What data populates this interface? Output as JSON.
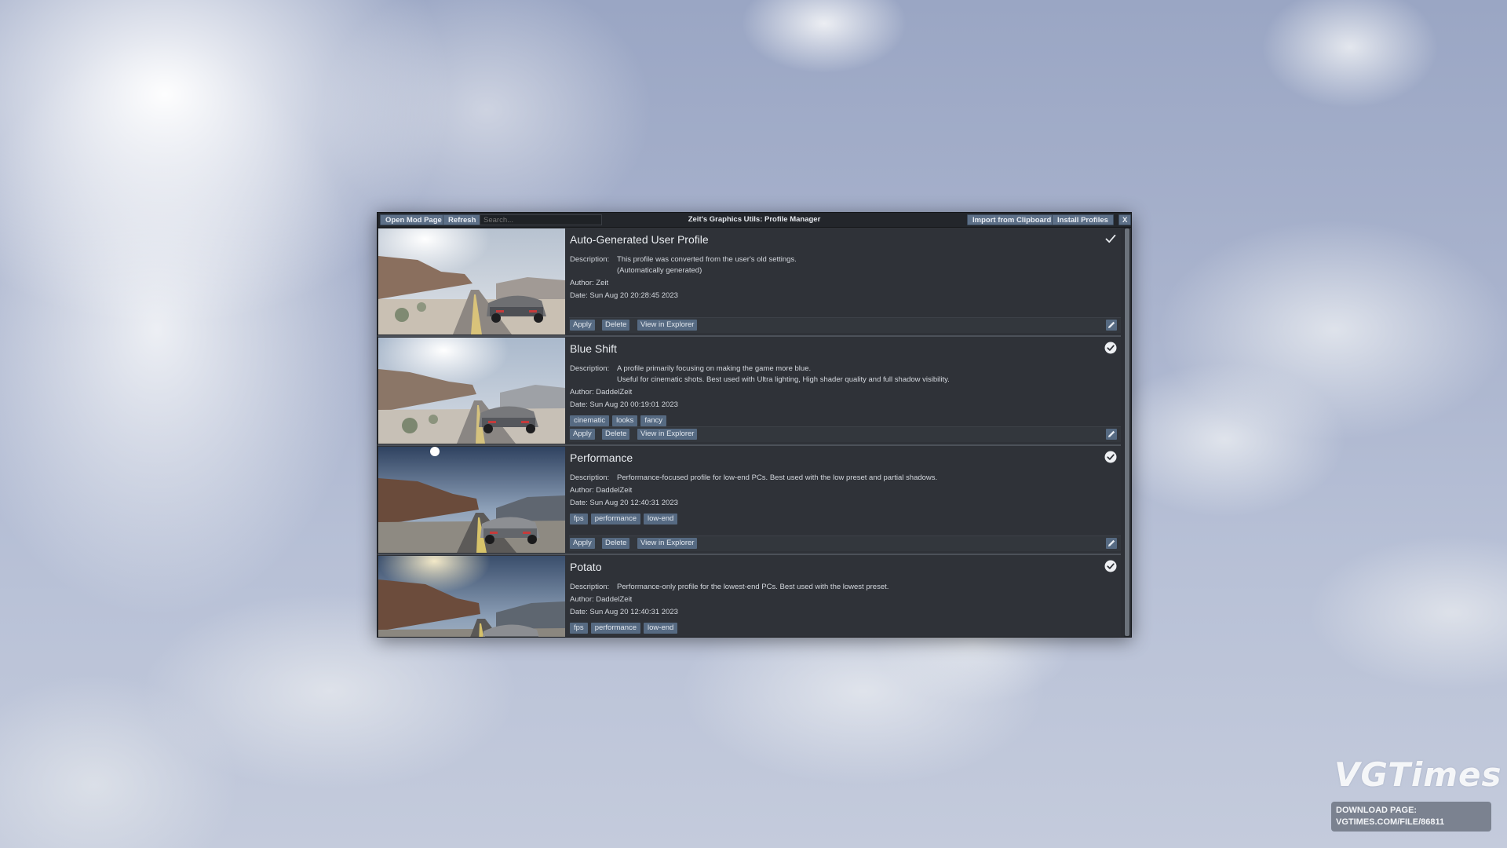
{
  "toolbar": {
    "open_mod_page": "Open Mod Page",
    "refresh": "Refresh",
    "search_placeholder": "Search...",
    "title": "Zeit's Graphics Utils: Profile Manager",
    "import_clipboard": "Import from Clipboard",
    "install_profiles": "Install Profiles",
    "close": "X"
  },
  "labels": {
    "description": "Description:",
    "author": "Author:",
    "date": "Date:",
    "apply": "Apply",
    "delete": "Delete",
    "view_in_explorer": "View in Explorer"
  },
  "profiles": [
    {
      "name": "Auto-Generated User Profile",
      "description": [
        "This profile was converted from the user's old settings.",
        "(Automatically generated)"
      ],
      "author": "Zeit",
      "date": "Sun Aug 20 20:28:45 2023",
      "tags": [],
      "status_icon": "check-icon"
    },
    {
      "name": "Blue Shift",
      "description": [
        "A profile primarily focusing on making the game more blue.",
        "Useful for cinematic shots. Best used with Ultra lighting, High shader quality and full shadow visibility."
      ],
      "author": "DaddelZeit",
      "date": "Sun Aug 20 00:19:01 2023",
      "tags": [
        "cinematic",
        "looks",
        "fancy"
      ],
      "status_icon": "check-circle-icon"
    },
    {
      "name": "Performance",
      "description": [
        "Performance-focused profile for low-end PCs. Best used with the low preset and partial shadows."
      ],
      "author": "DaddelZeit",
      "date": "Sun Aug 20 12:40:31 2023",
      "tags": [
        "fps",
        "performance",
        "low-end"
      ],
      "status_icon": "check-circle-icon"
    },
    {
      "name": "Potato",
      "description": [
        "Performance-only profile for the lowest-end PCs. Best used with the lowest preset."
      ],
      "author": "DaddelZeit",
      "date": "Sun Aug 20 12:40:31 2023",
      "tags": [
        "fps",
        "performance",
        "low-end"
      ],
      "status_icon": "check-circle-icon"
    }
  ],
  "overlay": {
    "watermark": "VGTimes",
    "download_line1": "DOWNLOAD PAGE:",
    "download_line2": "VGTIMES.COM/FILE/86811"
  },
  "colors": {
    "button_bg": "#566a82",
    "window_bg": "#2d3036",
    "title_bar_bg": "#23262b"
  }
}
